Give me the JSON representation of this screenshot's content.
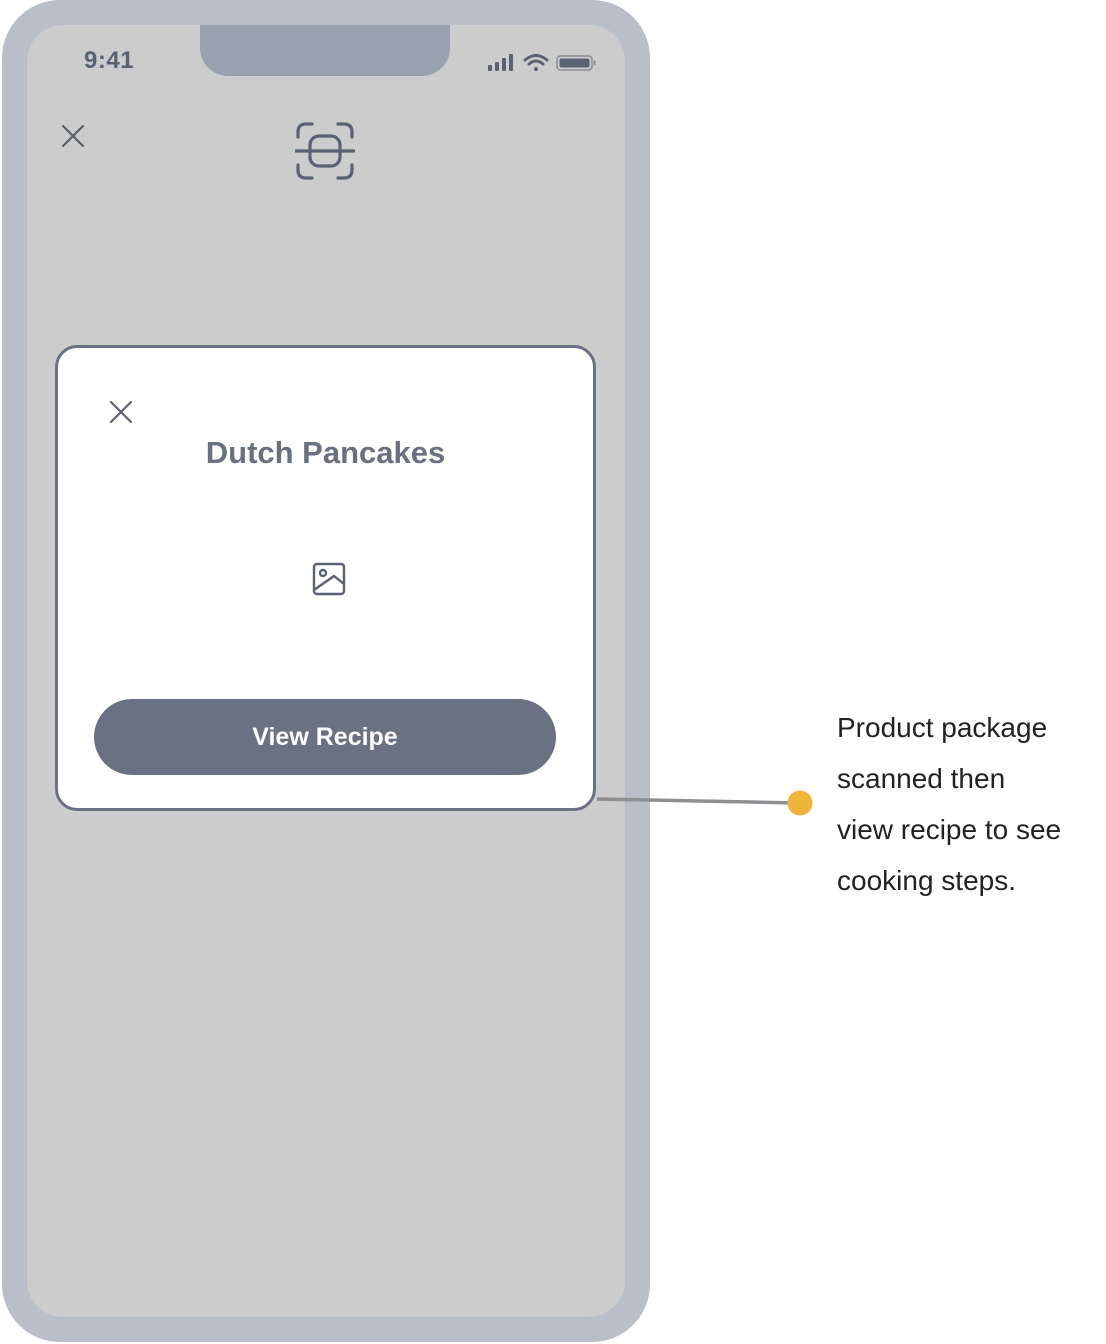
{
  "status_bar": {
    "time": "9:41"
  },
  "modal": {
    "title": "Dutch Pancakes",
    "button_label": "View Recipe"
  },
  "annotation": {
    "text": "Product package\nscanned then\nview recipe to see\ncooking steps."
  },
  "icons": {
    "close": "close-icon",
    "scan": "scan-icon",
    "image": "image-placeholder-icon",
    "signal": "cellular-signal-icon",
    "wifi": "wifi-icon",
    "battery": "battery-icon"
  },
  "colors": {
    "frame": "#b9bec8",
    "screen": "#cccccc",
    "notch": "#9aa1ae",
    "primary": "#697182",
    "annotation_dot": "#f0b43c"
  }
}
